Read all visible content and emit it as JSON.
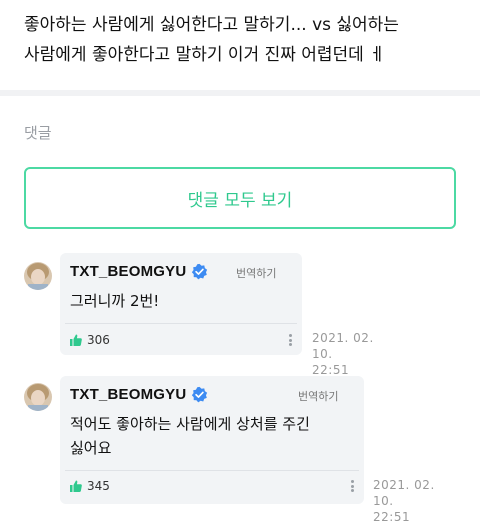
{
  "post": {
    "body": "좋아하는 사람에게 싫어한다고 말하기...  vs 싫어하는 사람에게 좋아한다고 말하기 이거 진짜 어렵던데 ㅔ"
  },
  "comments_section": {
    "label": "댓글",
    "view_all_label": "댓글 모두 보기"
  },
  "comments": [
    {
      "author": "TXT_BEOMGYU",
      "translate_label": "번역하기",
      "text": "그러니까 2번!",
      "likes": "306",
      "date_line1": "2021. 02. 10.",
      "date_line2": "22:51"
    },
    {
      "author": "TXT_BEOMGYU",
      "translate_label": "번역하기",
      "text": "적어도 좋아하는 사람에게 상처를 주긴 싫어요",
      "likes": "345",
      "date_line1": "2021. 02. 10.",
      "date_line2": "22:51"
    }
  ],
  "colors": {
    "accent": "#2fc98e",
    "verified": "#3d8bf2",
    "bubble_bg": "#f2f4f6"
  },
  "icons": [
    "verified-icon",
    "like-icon",
    "more-icon",
    "avatar"
  ]
}
